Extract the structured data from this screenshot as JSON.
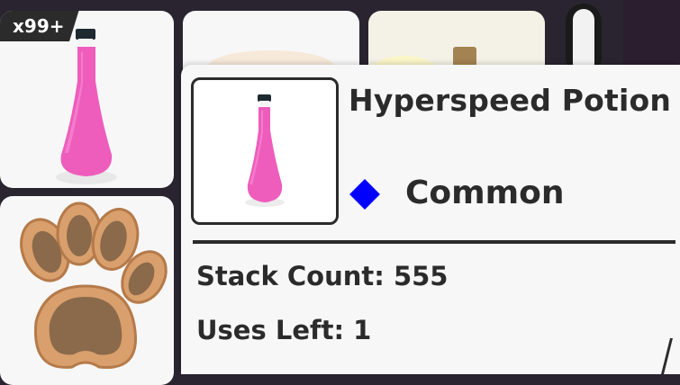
{
  "inventory": {
    "quantity_badge": "x99+",
    "slots": [
      {
        "icon": "pink-potion-icon"
      },
      {
        "icon": "paw-print-icon"
      },
      {
        "icon": "item-icon"
      },
      {
        "icon": "potion-bottle-icon"
      }
    ]
  },
  "tooltip": {
    "item_name": "Hyperspeed Potion",
    "rarity": "Common",
    "rarity_color": "#0000ff",
    "stack_count": "Stack Count: 555",
    "uses_left": "Uses Left: 1",
    "icon": "pink-potion-icon"
  }
}
